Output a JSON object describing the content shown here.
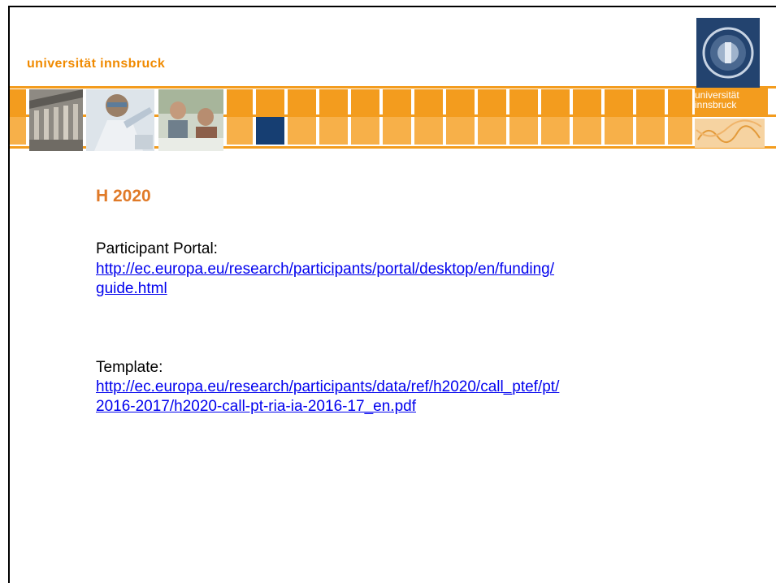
{
  "header": {
    "university_name": "universität innsbruck",
    "logo_text_line1": "universität",
    "logo_text_line2": "innsbruck"
  },
  "colors": {
    "accent_orange": "#f39c1e",
    "title_orange": "#e07a28",
    "navy": "#163e72",
    "link_blue": "#0000ee"
  },
  "slide": {
    "title": "H 2020",
    "sections": [
      {
        "label": "Participant Portal:",
        "link_line1": "http://ec.europa.eu/research/participants/portal/desktop/en/funding/",
        "link_line2": "guide.html"
      },
      {
        "label": "Template:",
        "link_line1": "http://ec.europa.eu/research/participants/data/ref/h2020/call_ptef/pt/",
        "link_line2": "2016-2017/h2020-call-pt-ria-ia-2016-17_en.pdf"
      }
    ]
  }
}
